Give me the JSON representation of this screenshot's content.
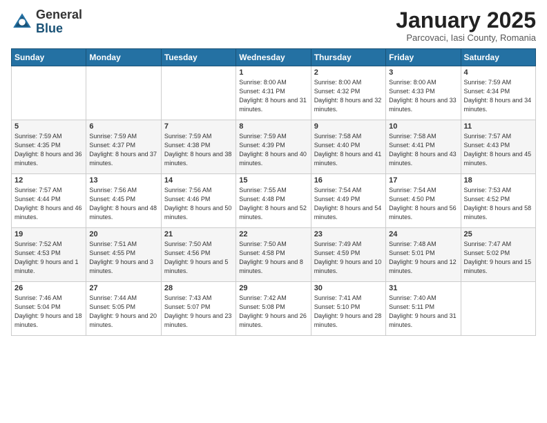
{
  "header": {
    "logo_general": "General",
    "logo_blue": "Blue",
    "month_title": "January 2025",
    "location": "Parcovaci, Iasi County, Romania"
  },
  "days_of_week": [
    "Sunday",
    "Monday",
    "Tuesday",
    "Wednesday",
    "Thursday",
    "Friday",
    "Saturday"
  ],
  "weeks": [
    [
      {
        "day": "",
        "sunrise": "",
        "sunset": "",
        "daylight": ""
      },
      {
        "day": "",
        "sunrise": "",
        "sunset": "",
        "daylight": ""
      },
      {
        "day": "",
        "sunrise": "",
        "sunset": "",
        "daylight": ""
      },
      {
        "day": "1",
        "sunrise": "Sunrise: 8:00 AM",
        "sunset": "Sunset: 4:31 PM",
        "daylight": "Daylight: 8 hours and 31 minutes."
      },
      {
        "day": "2",
        "sunrise": "Sunrise: 8:00 AM",
        "sunset": "Sunset: 4:32 PM",
        "daylight": "Daylight: 8 hours and 32 minutes."
      },
      {
        "day": "3",
        "sunrise": "Sunrise: 8:00 AM",
        "sunset": "Sunset: 4:33 PM",
        "daylight": "Daylight: 8 hours and 33 minutes."
      },
      {
        "day": "4",
        "sunrise": "Sunrise: 7:59 AM",
        "sunset": "Sunset: 4:34 PM",
        "daylight": "Daylight: 8 hours and 34 minutes."
      }
    ],
    [
      {
        "day": "5",
        "sunrise": "Sunrise: 7:59 AM",
        "sunset": "Sunset: 4:35 PM",
        "daylight": "Daylight: 8 hours and 36 minutes."
      },
      {
        "day": "6",
        "sunrise": "Sunrise: 7:59 AM",
        "sunset": "Sunset: 4:37 PM",
        "daylight": "Daylight: 8 hours and 37 minutes."
      },
      {
        "day": "7",
        "sunrise": "Sunrise: 7:59 AM",
        "sunset": "Sunset: 4:38 PM",
        "daylight": "Daylight: 8 hours and 38 minutes."
      },
      {
        "day": "8",
        "sunrise": "Sunrise: 7:59 AM",
        "sunset": "Sunset: 4:39 PM",
        "daylight": "Daylight: 8 hours and 40 minutes."
      },
      {
        "day": "9",
        "sunrise": "Sunrise: 7:58 AM",
        "sunset": "Sunset: 4:40 PM",
        "daylight": "Daylight: 8 hours and 41 minutes."
      },
      {
        "day": "10",
        "sunrise": "Sunrise: 7:58 AM",
        "sunset": "Sunset: 4:41 PM",
        "daylight": "Daylight: 8 hours and 43 minutes."
      },
      {
        "day": "11",
        "sunrise": "Sunrise: 7:57 AM",
        "sunset": "Sunset: 4:43 PM",
        "daylight": "Daylight: 8 hours and 45 minutes."
      }
    ],
    [
      {
        "day": "12",
        "sunrise": "Sunrise: 7:57 AM",
        "sunset": "Sunset: 4:44 PM",
        "daylight": "Daylight: 8 hours and 46 minutes."
      },
      {
        "day": "13",
        "sunrise": "Sunrise: 7:56 AM",
        "sunset": "Sunset: 4:45 PM",
        "daylight": "Daylight: 8 hours and 48 minutes."
      },
      {
        "day": "14",
        "sunrise": "Sunrise: 7:56 AM",
        "sunset": "Sunset: 4:46 PM",
        "daylight": "Daylight: 8 hours and 50 minutes."
      },
      {
        "day": "15",
        "sunrise": "Sunrise: 7:55 AM",
        "sunset": "Sunset: 4:48 PM",
        "daylight": "Daylight: 8 hours and 52 minutes."
      },
      {
        "day": "16",
        "sunrise": "Sunrise: 7:54 AM",
        "sunset": "Sunset: 4:49 PM",
        "daylight": "Daylight: 8 hours and 54 minutes."
      },
      {
        "day": "17",
        "sunrise": "Sunrise: 7:54 AM",
        "sunset": "Sunset: 4:50 PM",
        "daylight": "Daylight: 8 hours and 56 minutes."
      },
      {
        "day": "18",
        "sunrise": "Sunrise: 7:53 AM",
        "sunset": "Sunset: 4:52 PM",
        "daylight": "Daylight: 8 hours and 58 minutes."
      }
    ],
    [
      {
        "day": "19",
        "sunrise": "Sunrise: 7:52 AM",
        "sunset": "Sunset: 4:53 PM",
        "daylight": "Daylight: 9 hours and 1 minute."
      },
      {
        "day": "20",
        "sunrise": "Sunrise: 7:51 AM",
        "sunset": "Sunset: 4:55 PM",
        "daylight": "Daylight: 9 hours and 3 minutes."
      },
      {
        "day": "21",
        "sunrise": "Sunrise: 7:50 AM",
        "sunset": "Sunset: 4:56 PM",
        "daylight": "Daylight: 9 hours and 5 minutes."
      },
      {
        "day": "22",
        "sunrise": "Sunrise: 7:50 AM",
        "sunset": "Sunset: 4:58 PM",
        "daylight": "Daylight: 9 hours and 8 minutes."
      },
      {
        "day": "23",
        "sunrise": "Sunrise: 7:49 AM",
        "sunset": "Sunset: 4:59 PM",
        "daylight": "Daylight: 9 hours and 10 minutes."
      },
      {
        "day": "24",
        "sunrise": "Sunrise: 7:48 AM",
        "sunset": "Sunset: 5:01 PM",
        "daylight": "Daylight: 9 hours and 12 minutes."
      },
      {
        "day": "25",
        "sunrise": "Sunrise: 7:47 AM",
        "sunset": "Sunset: 5:02 PM",
        "daylight": "Daylight: 9 hours and 15 minutes."
      }
    ],
    [
      {
        "day": "26",
        "sunrise": "Sunrise: 7:46 AM",
        "sunset": "Sunset: 5:04 PM",
        "daylight": "Daylight: 9 hours and 18 minutes."
      },
      {
        "day": "27",
        "sunrise": "Sunrise: 7:44 AM",
        "sunset": "Sunset: 5:05 PM",
        "daylight": "Daylight: 9 hours and 20 minutes."
      },
      {
        "day": "28",
        "sunrise": "Sunrise: 7:43 AM",
        "sunset": "Sunset: 5:07 PM",
        "daylight": "Daylight: 9 hours and 23 minutes."
      },
      {
        "day": "29",
        "sunrise": "Sunrise: 7:42 AM",
        "sunset": "Sunset: 5:08 PM",
        "daylight": "Daylight: 9 hours and 26 minutes."
      },
      {
        "day": "30",
        "sunrise": "Sunrise: 7:41 AM",
        "sunset": "Sunset: 5:10 PM",
        "daylight": "Daylight: 9 hours and 28 minutes."
      },
      {
        "day": "31",
        "sunrise": "Sunrise: 7:40 AM",
        "sunset": "Sunset: 5:11 PM",
        "daylight": "Daylight: 9 hours and 31 minutes."
      },
      {
        "day": "",
        "sunrise": "",
        "sunset": "",
        "daylight": ""
      }
    ]
  ]
}
